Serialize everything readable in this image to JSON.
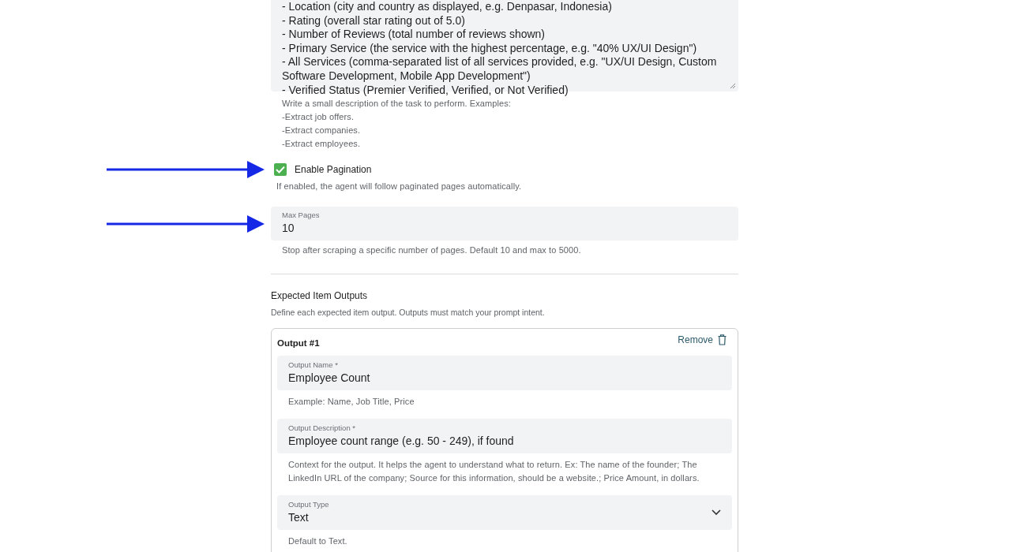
{
  "prompt_field": {
    "value_lines": [
      "- Location (city and country as displayed, e.g. Denpasar, Indonesia)",
      "- Rating (overall star rating out of 5.0)",
      "- Number of Reviews (total number of reviews shown)",
      "- Primary Service (the service with the highest percentage, e.g. \"40% UX/UI Design\")",
      "- All Services (comma-separated list of all services provided, e.g. \"UX/UI Design, Custom Software Development, Mobile App Development\")",
      "- Verified Status (Premier Verified, Verified, or Not Verified)"
    ],
    "helper_lines": [
      "Write a small description of the task to perform. Examples:",
      "-Extract job offers.",
      "-Extract companies.",
      "-Extract employees."
    ]
  },
  "pagination": {
    "label": "Enable Pagination",
    "checked": true,
    "helper": "If enabled, the agent will follow paginated pages automatically."
  },
  "max_pages": {
    "label": "Max Pages",
    "value": "10",
    "helper": "Stop after scraping a specific number of pages. Default 10 and max to 5000."
  },
  "outputs_section": {
    "title": "Expected Item Outputs",
    "description": "Define each expected item output. Outputs must match your prompt intent."
  },
  "outputs": [
    {
      "title": "Output #1",
      "remove_label": "Remove",
      "fields": [
        {
          "kind": "text",
          "label": "Output Name *",
          "value": "Employee Count",
          "helper": "Example: Name, Job Title, Price"
        },
        {
          "kind": "text",
          "label": "Output Description *",
          "value": "Employee count range (e.g. 50 - 249), if found",
          "helper": "Context for the output. It helps the agent to understand what to return. Ex: The name of the founder; The LinkedIn URL of the company; Source for this information, should be a website.; Price Amount, in dollars."
        },
        {
          "kind": "select",
          "label": "Output Type",
          "value": "Text",
          "helper": "Default to Text."
        }
      ]
    }
  ]
}
